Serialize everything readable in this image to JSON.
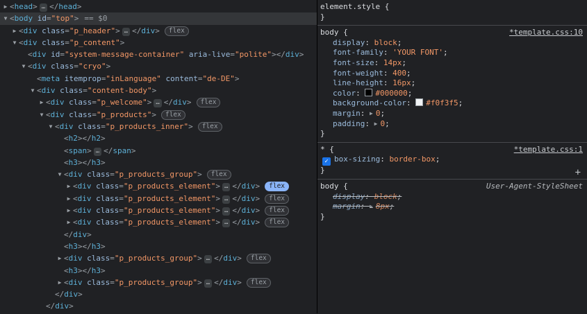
{
  "theme": {
    "background": "#202124",
    "tag_color": "#5DB0D7",
    "attr_name_color": "#9BBBDC",
    "attr_value_color": "#F29766",
    "badge_active_color": "#8AB4F8",
    "accent_blue": "#1A73E8"
  },
  "dom_tree": {
    "selected_node_hint": "== $0",
    "rows": [
      {
        "indent": 0,
        "arrow": "collapsed",
        "tag": "head",
        "attrs": [],
        "ellipsis": true,
        "close": true
      },
      {
        "indent": 0,
        "arrow": "expanded",
        "tag": "body",
        "attrs": [
          {
            "name": "id",
            "value": "top"
          }
        ],
        "suffix": "== $0",
        "selected": true
      },
      {
        "indent": 1,
        "arrow": "collapsed",
        "tag": "div",
        "attrs": [
          {
            "name": "class",
            "value": "p_header"
          }
        ],
        "ellipsis": true,
        "close": true,
        "badge": {
          "label": "flex",
          "active": false
        }
      },
      {
        "indent": 1,
        "arrow": "expanded",
        "tag": "div",
        "attrs": [
          {
            "name": "class",
            "value": "p_content"
          }
        ]
      },
      {
        "indent": 2,
        "tag": "div",
        "attrs": [
          {
            "name": "id",
            "value": "system-message-container"
          },
          {
            "name": "aria-live",
            "value": "polite"
          }
        ],
        "close": true
      },
      {
        "indent": 2,
        "arrow": "expanded",
        "tag": "div",
        "attrs": [
          {
            "name": "class",
            "value": "cryo"
          }
        ]
      },
      {
        "indent": 3,
        "tag": "meta",
        "attrs": [
          {
            "name": "itemprop",
            "value": "inLanguage"
          },
          {
            "name": "content",
            "value": "de-DE"
          }
        ]
      },
      {
        "indent": 3,
        "arrow": "expanded",
        "tag": "div",
        "attrs": [
          {
            "name": "class",
            "value": "content-body"
          }
        ]
      },
      {
        "indent": 4,
        "arrow": "collapsed",
        "tag": "div",
        "attrs": [
          {
            "name": "class",
            "value": "p_welcome"
          }
        ],
        "ellipsis": true,
        "close": true,
        "badge": {
          "label": "flex",
          "active": false
        }
      },
      {
        "indent": 4,
        "arrow": "expanded",
        "tag": "div",
        "attrs": [
          {
            "name": "class",
            "value": "p_products"
          }
        ],
        "badge": {
          "label": "flex",
          "active": false
        }
      },
      {
        "indent": 5,
        "arrow": "expanded",
        "tag": "div",
        "attrs": [
          {
            "name": "class",
            "value": "p_products_inner"
          }
        ],
        "badge": {
          "label": "flex",
          "active": false
        }
      },
      {
        "indent": 6,
        "tag": "h2",
        "attrs": [],
        "close": true
      },
      {
        "indent": 6,
        "tag": "span",
        "attrs": [],
        "ellipsis": true,
        "close": true
      },
      {
        "indent": 6,
        "tag": "h3",
        "attrs": [],
        "close": true
      },
      {
        "indent": 6,
        "arrow": "expanded",
        "tag": "div",
        "attrs": [
          {
            "name": "class",
            "value": "p_products_group"
          }
        ],
        "badge": {
          "label": "flex",
          "active": false
        }
      },
      {
        "indent": 7,
        "arrow": "collapsed",
        "tag": "div",
        "attrs": [
          {
            "name": "class",
            "value": "p_products_element"
          }
        ],
        "ellipsis": true,
        "close": true,
        "badge": {
          "label": "flex",
          "active": true
        }
      },
      {
        "indent": 7,
        "arrow": "collapsed",
        "tag": "div",
        "attrs": [
          {
            "name": "class",
            "value": "p_products_element"
          }
        ],
        "ellipsis": true,
        "close": true,
        "badge": {
          "label": "flex",
          "active": false
        }
      },
      {
        "indent": 7,
        "arrow": "collapsed",
        "tag": "div",
        "attrs": [
          {
            "name": "class",
            "value": "p_products_element"
          }
        ],
        "ellipsis": true,
        "close": true,
        "badge": {
          "label": "flex",
          "active": false
        }
      },
      {
        "indent": 7,
        "arrow": "collapsed",
        "tag": "div",
        "attrs": [
          {
            "name": "class",
            "value": "p_products_element"
          }
        ],
        "ellipsis": true,
        "close": true,
        "badge": {
          "label": "flex",
          "active": false
        }
      },
      {
        "indent": 6,
        "close_only": "div"
      },
      {
        "indent": 6,
        "tag": "h3",
        "attrs": [],
        "close": true
      },
      {
        "indent": 6,
        "arrow": "collapsed",
        "tag": "div",
        "attrs": [
          {
            "name": "class",
            "value": "p_products_group"
          }
        ],
        "ellipsis": true,
        "close": true,
        "badge": {
          "label": "flex",
          "active": false
        }
      },
      {
        "indent": 6,
        "tag": "h3",
        "attrs": [],
        "close": true
      },
      {
        "indent": 6,
        "arrow": "collapsed",
        "tag": "div",
        "attrs": [
          {
            "name": "class",
            "value": "p_products_group"
          }
        ],
        "ellipsis": true,
        "close": true,
        "badge": {
          "label": "flex",
          "active": false
        }
      },
      {
        "indent": 5,
        "close_only": "div"
      },
      {
        "indent": 4,
        "close_only": "div"
      }
    ]
  },
  "styles_panel": {
    "sections": [
      {
        "selector": "element.style",
        "props": []
      },
      {
        "selector": "body",
        "source": "*template.css:10",
        "props": [
          {
            "name": "display",
            "value": "block"
          },
          {
            "name": "font-family",
            "value": "'YOUR FONT'"
          },
          {
            "name": "font-size",
            "value": "14px"
          },
          {
            "name": "font-weight",
            "value": "400"
          },
          {
            "name": "line-height",
            "value": "16px"
          },
          {
            "name": "color",
            "value": "#000000",
            "swatch": "#000000"
          },
          {
            "name": "background-color",
            "value": "#f0f3f5",
            "swatch": "#f0f3f5"
          },
          {
            "name": "margin",
            "value": "0",
            "expandable": true
          },
          {
            "name": "padding",
            "value": "0",
            "expandable": true
          }
        ]
      },
      {
        "selector": "*",
        "source": "*template.css:1",
        "has_add_button": true,
        "add_button_label": "+",
        "props": [
          {
            "name": "box-sizing",
            "value": "border-box",
            "checkbox": true
          }
        ]
      },
      {
        "selector": "body",
        "source": "User-Agent-StyleSheet",
        "source_italic": true,
        "props": [
          {
            "name": "display",
            "value": "block",
            "overridden": true
          },
          {
            "name": "margin",
            "value": "8px",
            "overridden": true,
            "expandable": true
          }
        ]
      }
    ]
  }
}
